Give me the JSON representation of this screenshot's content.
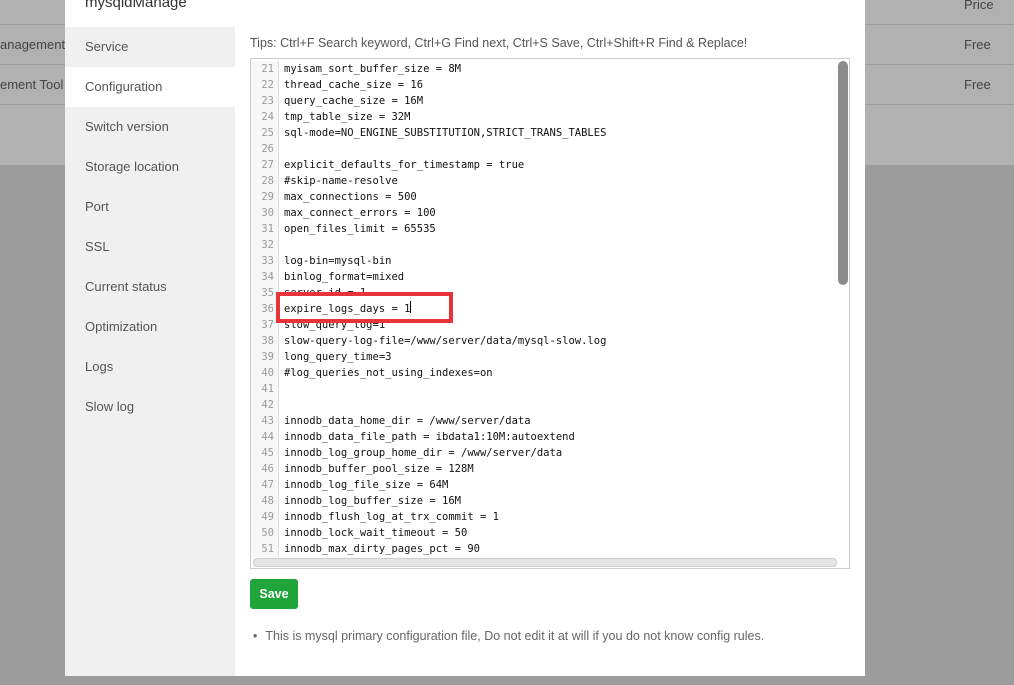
{
  "background": {
    "header_price": "Price",
    "rows": [
      {
        "name": "anagement",
        "price": "Free"
      },
      {
        "name": "ement Tool",
        "price": "Free"
      }
    ]
  },
  "modal": {
    "title": "mysqldManage",
    "sidebar": [
      "Service",
      "Configuration",
      "Switch version",
      "Storage location",
      "Port",
      "SSL",
      "Current status",
      "Optimization",
      "Logs",
      "Slow log"
    ],
    "active_index": 1,
    "tips": "Tips:  Ctrl+F Search keyword,  Ctrl+G Find next,  Ctrl+S Save,  Ctrl+Shift+R Find & Replace!",
    "lines": [
      {
        "n": "21",
        "t": "myisam_sort_buffer_size = 8M"
      },
      {
        "n": "22",
        "t": "thread_cache_size = 16"
      },
      {
        "n": "23",
        "t": "query_cache_size = 16M"
      },
      {
        "n": "24",
        "t": "tmp_table_size = 32M"
      },
      {
        "n": "25",
        "t": "sql-mode=NO_ENGINE_SUBSTITUTION,STRICT_TRANS_TABLES"
      },
      {
        "n": "26",
        "t": ""
      },
      {
        "n": "27",
        "t": "explicit_defaults_for_timestamp = true"
      },
      {
        "n": "28",
        "t": "#skip-name-resolve"
      },
      {
        "n": "29",
        "t": "max_connections = 500"
      },
      {
        "n": "30",
        "t": "max_connect_errors = 100"
      },
      {
        "n": "31",
        "t": "open_files_limit = 65535"
      },
      {
        "n": "32",
        "t": ""
      },
      {
        "n": "33",
        "t": "log-bin=mysql-bin"
      },
      {
        "n": "34",
        "t": "binlog_format=mixed"
      },
      {
        "n": "35",
        "t": "server-id = 1"
      },
      {
        "n": "36",
        "t": "expire_logs_days = 1"
      },
      {
        "n": "37",
        "t": "slow_query_log=1"
      },
      {
        "n": "38",
        "t": "slow-query-log-file=/www/server/data/mysql-slow.log"
      },
      {
        "n": "39",
        "t": "long_query_time=3"
      },
      {
        "n": "40",
        "t": "#log_queries_not_using_indexes=on"
      },
      {
        "n": "41",
        "t": ""
      },
      {
        "n": "42",
        "t": ""
      },
      {
        "n": "43",
        "t": "innodb_data_home_dir = /www/server/data"
      },
      {
        "n": "44",
        "t": "innodb_data_file_path = ibdata1:10M:autoextend"
      },
      {
        "n": "45",
        "t": "innodb_log_group_home_dir = /www/server/data"
      },
      {
        "n": "46",
        "t": "innodb_buffer_pool_size = 128M"
      },
      {
        "n": "47",
        "t": "innodb_log_file_size = 64M"
      },
      {
        "n": "48",
        "t": "innodb_log_buffer_size = 16M"
      },
      {
        "n": "49",
        "t": "innodb_flush_log_at_trx_commit = 1"
      },
      {
        "n": "50",
        "t": "innodb_lock_wait_timeout = 50"
      },
      {
        "n": "51",
        "t": "innodb_max_dirty_pages_pct = 90"
      }
    ],
    "save_label": "Save",
    "note": "This is mysql primary configuration file, Do not edit it at will if you do not know config rules."
  },
  "colors": {
    "accent": "#20a53a",
    "highlight": "#e8333a"
  }
}
